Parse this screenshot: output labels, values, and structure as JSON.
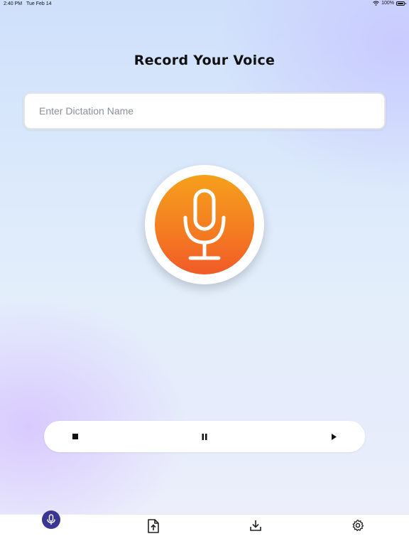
{
  "status_bar": {
    "time": "2:40 PM",
    "date": "Tue Feb 14",
    "battery": "100%"
  },
  "page": {
    "title": "Record Your Voice"
  },
  "dictation": {
    "placeholder": "Enter Dictation Name",
    "value": ""
  },
  "record_button": {
    "icon": "microphone-icon",
    "colors": [
      "#f5a01c",
      "#f05a28"
    ]
  },
  "controls": {
    "stop_icon": "stop-icon",
    "pause_icon": "pause-icon",
    "play_icon": "play-icon"
  },
  "tab_bar": {
    "active_color": "#3a3692",
    "tabs": [
      {
        "icon": "microphone-icon",
        "active": true
      },
      {
        "icon": "upload-file-icon",
        "active": false
      },
      {
        "icon": "download-icon",
        "active": false
      },
      {
        "icon": "gear-icon",
        "active": false
      }
    ]
  }
}
